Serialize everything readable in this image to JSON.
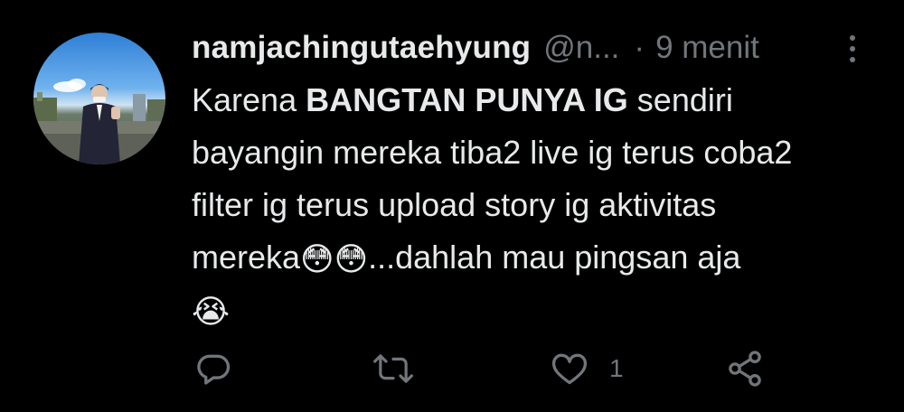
{
  "tweet": {
    "author": {
      "display_name": "namjachingutaehyung",
      "handle": "@n...",
      "separator": "·",
      "time": "9 menit"
    },
    "body": {
      "line1_prefix": "Karena ",
      "line1_bold": "BANGTAN PUNYA IG",
      "line1_suffix": " sendiri",
      "line2": "bayangin mereka tiba2 live ig terus coba2",
      "line3": "filter ig terus upload story ig aktivitas",
      "line4_word": "mereka",
      "line4_emoji": "😳😳",
      "line4_suffix": "...dahlah mau pingsan aja",
      "line5_emoji": "😭"
    },
    "actions": {
      "reply": {
        "icon": "reply-icon",
        "count": ""
      },
      "retweet": {
        "icon": "retweet-icon",
        "count": ""
      },
      "like": {
        "icon": "heart-icon",
        "count": "1"
      },
      "share": {
        "icon": "share-icon",
        "count": ""
      }
    },
    "colors": {
      "background": "#000000",
      "text": "#e7e9ea",
      "muted": "#71767b"
    }
  }
}
